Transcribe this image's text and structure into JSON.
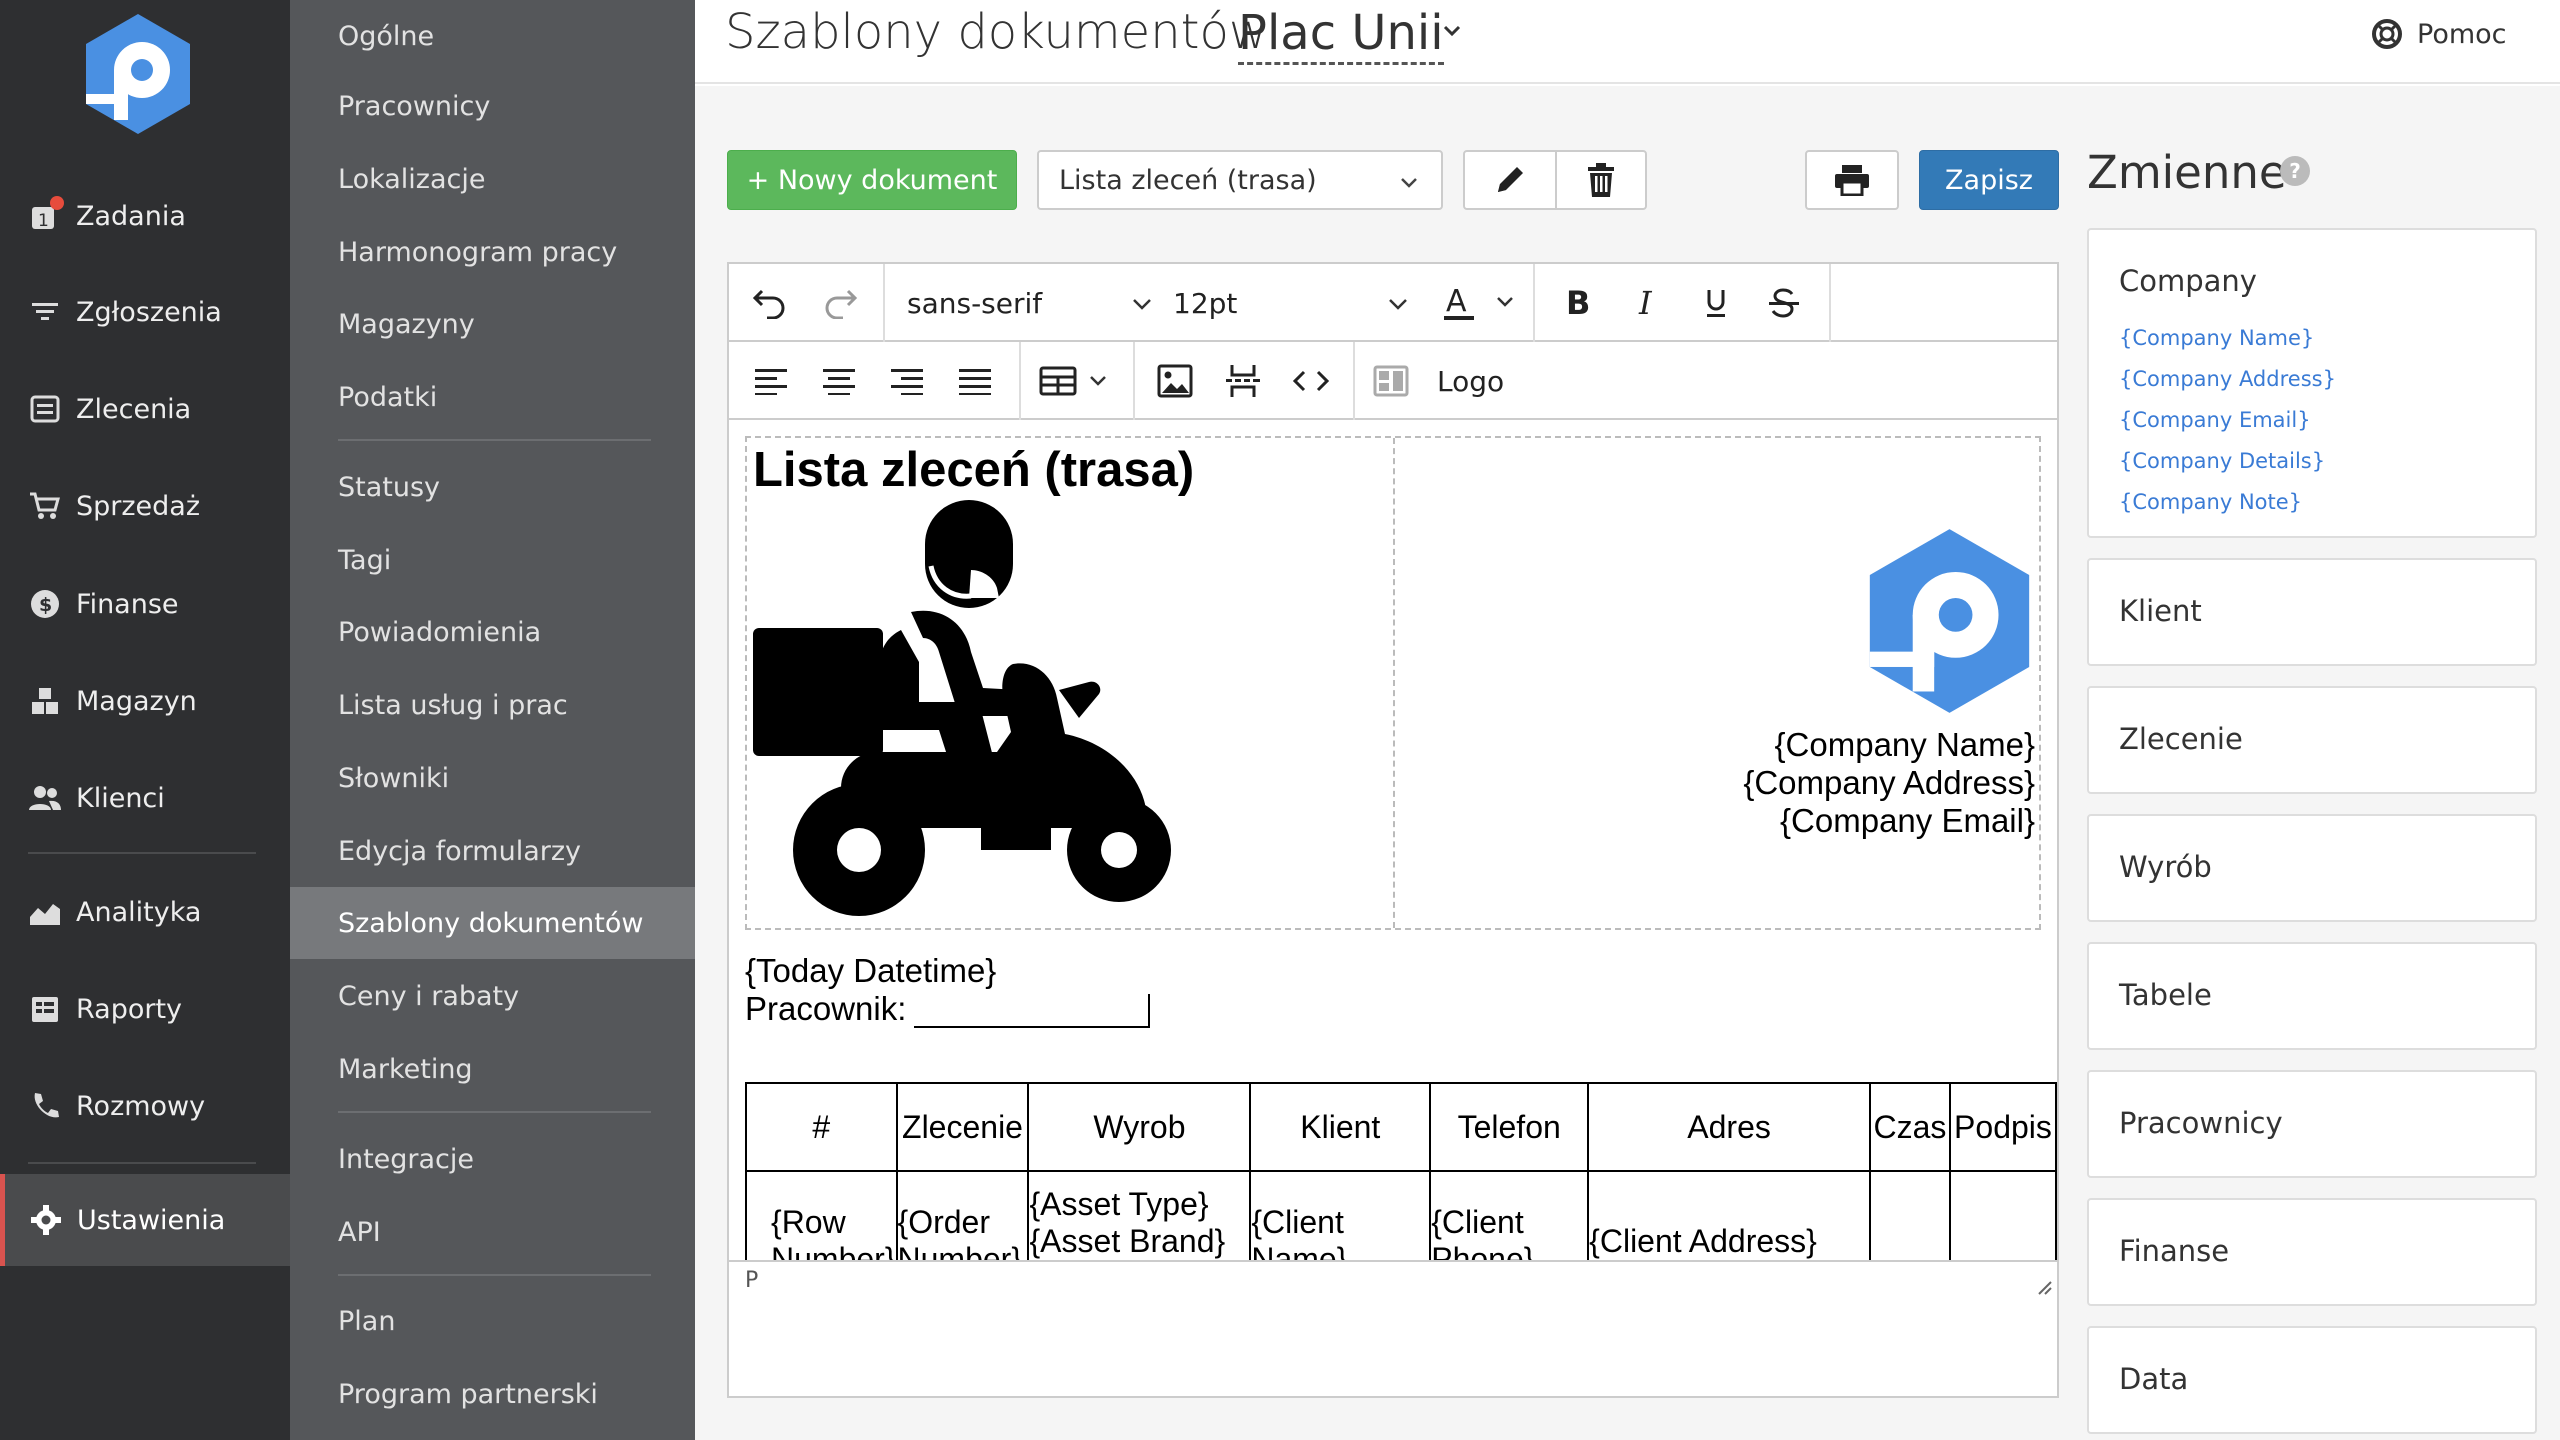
{
  "nav": {
    "items": [
      {
        "label": "Zadania",
        "icon": "tasks-icon",
        "badge": "1"
      },
      {
        "label": "Zgłoszenia",
        "icon": "filter-icon"
      },
      {
        "label": "Zlecenia",
        "icon": "orders-icon"
      },
      {
        "label": "Sprzedaż",
        "icon": "cart-icon"
      },
      {
        "label": "Finanse",
        "icon": "dollar-icon"
      },
      {
        "label": "Magazyn",
        "icon": "boxes-icon"
      },
      {
        "label": "Klienci",
        "icon": "users-icon"
      },
      {
        "label": "Analityka",
        "icon": "chart-icon"
      },
      {
        "label": "Raporty",
        "icon": "reports-icon"
      },
      {
        "label": "Rozmowy",
        "icon": "phone-icon"
      },
      {
        "label": "Ustawienia",
        "icon": "gear-icon"
      }
    ]
  },
  "subnav": {
    "items": [
      "Ogólne",
      "Pracownicy",
      "Lokalizacje",
      "Harmonogram pracy",
      "Magazyny",
      "Podatki",
      "Statusy",
      "Tagi",
      "Powiadomienia",
      "Lista usług i prac",
      "Słowniki",
      "Edycja formularzy",
      "Szablony dokumentów",
      "Ceny i rabaty",
      "Marketing",
      "Integracje",
      "API",
      "Plan",
      "Program partnerski"
    ],
    "active": "Szablony dokumentów"
  },
  "header": {
    "title": "Szablony dokumentów",
    "location": "Plac Unii",
    "help": "Pomoc"
  },
  "toolbar": {
    "new_doc": "+ Nowy dokument",
    "template_selected": "Lista zleceń (trasa)",
    "save": "Zapisz"
  },
  "editor": {
    "font_family": "sans-serif",
    "font_size": "12pt",
    "logo_label": "Logo",
    "status_path": "P"
  },
  "document": {
    "title": "Lista zleceń (trasa)",
    "company_name": "{Company Name}",
    "company_address": "{Company Address}",
    "company_email": "{Company Email}",
    "today": "{Today Datetime}",
    "worker_label": "Pracownik:",
    "table": {
      "headers": [
        "#",
        "Zlecenie",
        "Wyrob",
        "Klient",
        "Telefon",
        "Adres",
        "Czas",
        "Podpis"
      ],
      "row": [
        "{Row Number}",
        "{Order Number}",
        "{Asset Type} {Asset Brand} {Asset Model}",
        "{Client Name}",
        "{Client Phone}",
        "{Client Address}",
        "",
        ""
      ]
    }
  },
  "variables": {
    "title": "Zmienne",
    "help": "?",
    "company": {
      "title": "Company",
      "items": [
        "{Company Name}",
        "{Company Address}",
        "{Company Email}",
        "{Company Details}",
        "{Company Note}"
      ]
    },
    "groups": [
      "Klient",
      "Zlecenie",
      "Wyrób",
      "Tabele",
      "Pracownicy",
      "Finanse",
      "Data"
    ]
  },
  "colors": {
    "nav_bg": "#2e2f31",
    "subnav_bg": "#55575a",
    "subnav_active": "#77797c",
    "primary": "#337ab7",
    "success": "#5cb85c",
    "logo_blue": "#4a90e2",
    "link": "#3a7bd5"
  }
}
